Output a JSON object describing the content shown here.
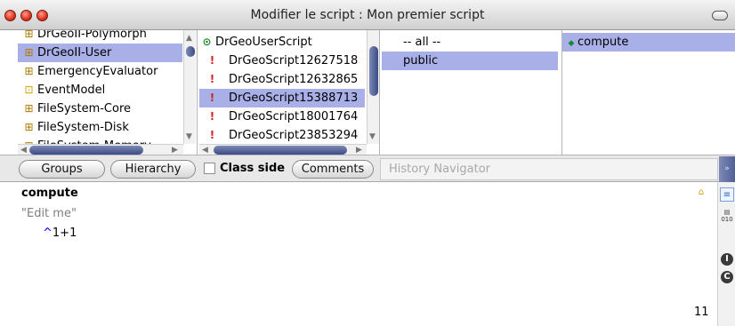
{
  "window": {
    "title": "Modifier le script : Mon premier script"
  },
  "packages": [
    {
      "label": "DrGeoII-Polymorph",
      "icon": "package-icon"
    },
    {
      "label": "DrGeoII-User",
      "icon": "package-icon",
      "selected": true
    },
    {
      "label": "EmergencyEvaluator",
      "icon": "package-icon"
    },
    {
      "label": "EventModel",
      "icon": "package-icon"
    },
    {
      "label": "FileSystem-Core",
      "icon": "package-icon"
    },
    {
      "label": "FileSystem-Disk",
      "icon": "package-icon"
    },
    {
      "label": "FileSystem-Memory",
      "icon": "package-icon"
    }
  ],
  "classes": [
    {
      "label": "DrGeoUserScript",
      "icon": "class-icon"
    },
    {
      "label": "DrGeoScript12627518",
      "icon": "warning-icon"
    },
    {
      "label": "DrGeoScript12632865",
      "icon": "warning-icon"
    },
    {
      "label": "DrGeoScript15388713",
      "icon": "warning-icon",
      "selected": true
    },
    {
      "label": "DrGeoScript18001764",
      "icon": "warning-icon"
    },
    {
      "label": "DrGeoScript23853294",
      "icon": "warning-icon"
    }
  ],
  "protocols": [
    {
      "label": "-- all --"
    },
    {
      "label": "public",
      "selected": true
    }
  ],
  "methods": [
    {
      "label": "compute",
      "icon": "method-icon",
      "selected": true
    }
  ],
  "buttons": {
    "groups": "Groups",
    "hierarchy": "Hierarchy",
    "class_side": "Class side",
    "comments": "Comments",
    "history_placeholder": "History Navigator"
  },
  "editor": {
    "method_name": "compute",
    "comment": "\"Edit me\"",
    "code_caret": "^",
    "code_body": "1+1",
    "line_number": "11"
  },
  "colors": {
    "selection": "#a9b0e8",
    "comment": "#808080",
    "caret": "#0000ff"
  }
}
